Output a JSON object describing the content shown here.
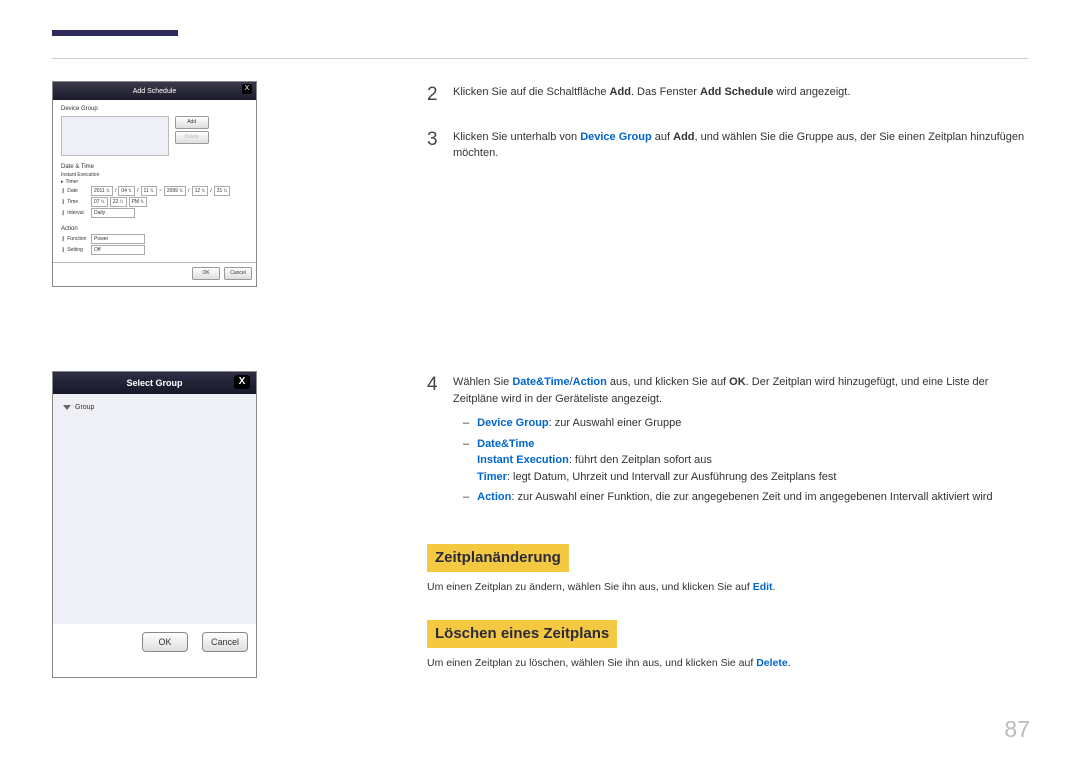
{
  "screenshot1": {
    "title": "Add Schedule",
    "close": "X",
    "deviceGroup": "Device Group",
    "addBtn": "Add",
    "deleteBtn": "Delete",
    "dateTime": "Date & Time",
    "instant": "Instant Execution",
    "timer": "Timer",
    "dateLbl": "Date",
    "date_y1": "2011",
    "date_m1": "04",
    "date_d1": "11",
    "date_y2": "2099",
    "date_m2": "12",
    "date_d2": "31",
    "timeLbl": "Time",
    "time_h": "07",
    "time_m": "22",
    "time_am": "PM",
    "intervalLbl": "Interval",
    "interval": "Daily",
    "action": "Action",
    "functionLbl": "Function",
    "function": "Power",
    "settingLbl": "Setting",
    "setting": "Off",
    "ok": "OK",
    "cancel": "Cancel"
  },
  "screenshot2": {
    "title": "Select Group",
    "close": "X",
    "group": "Group",
    "ok": "OK",
    "cancel": "Cancel"
  },
  "steps": {
    "s2": {
      "num": "2",
      "t1": "Klicken Sie auf die Schaltfläche ",
      "b1": "Add",
      "t2": ". Das Fenster ",
      "b2": "Add Schedule",
      "t3": " wird angezeigt."
    },
    "s3": {
      "num": "3",
      "t1": "Klicken Sie unterhalb von ",
      "c1": "Device Group",
      "t2": " auf ",
      "b1": "Add",
      "t3": ", und wählen Sie die Gruppe aus, der Sie einen Zeitplan hinzufügen möchten."
    },
    "s4": {
      "num": "4",
      "t1": "Wählen Sie ",
      "c1": "Date&Time",
      "slash": "/",
      "c2": "Action",
      "t2": " aus, und klicken Sie auf ",
      "b1": "OK",
      "t3": ". Der Zeitplan wird hinzugefügt, und eine Liste der Zeitpläne wird in der Geräteliste angezeigt.",
      "sub1_c": "Device Group",
      "sub1_t": ": zur Auswahl einer Gruppe",
      "sub2_c": "Date&Time",
      "sub2a_c": "Instant Execution",
      "sub2a_t": ": führt den Zeitplan sofort aus",
      "sub2b_c": "Timer",
      "sub2b_t": ": legt Datum, Uhrzeit und Intervall zur Ausführung des Zeitplans fest",
      "sub3_c": "Action",
      "sub3_t": ": zur Auswahl einer Funktion, die zur angegebenen Zeit und im angegebenen Intervall aktiviert wird"
    }
  },
  "h1": "Zeitplanänderung",
  "p1_t1": "Um einen Zeitplan zu ändern, wählen Sie ihn aus, und klicken Sie auf ",
  "p1_c": "Edit",
  "p1_t2": ".",
  "h2": "Löschen eines Zeitplans",
  "p2_t1": "Um einen Zeitplan zu löschen, wählen Sie ihn aus, und klicken Sie auf ",
  "p2_c": "Delete",
  "p2_t2": ".",
  "pagenum": "87"
}
